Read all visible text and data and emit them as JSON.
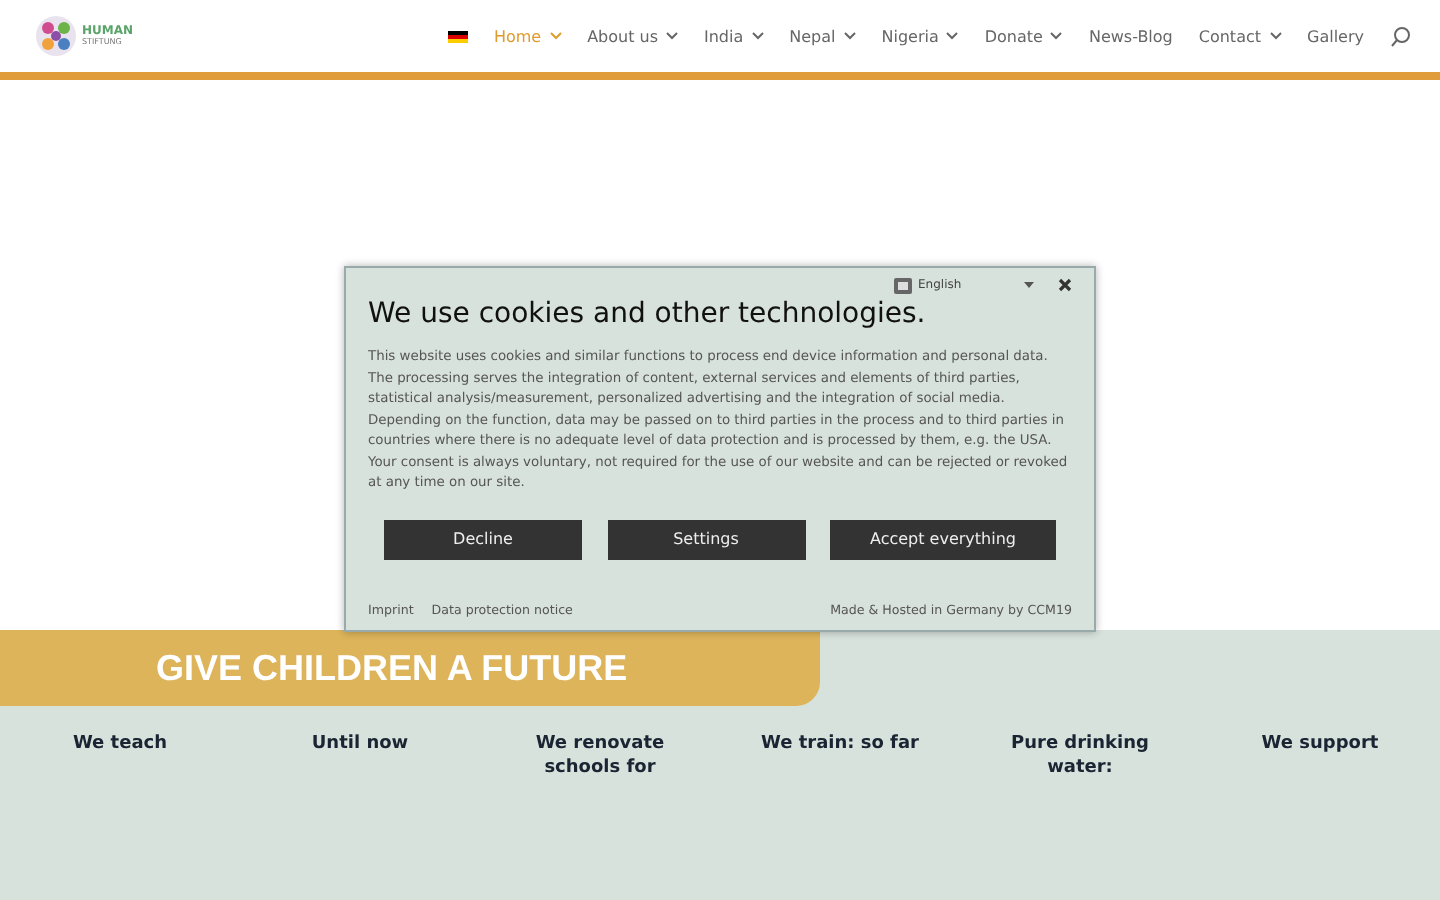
{
  "header": {
    "logo_text": "HUMAN",
    "logo_subtext": "STIFTUNG",
    "nav": [
      {
        "label": "Home",
        "selected": true,
        "has_menu": true
      },
      {
        "label": "About us",
        "selected": false,
        "has_menu": true
      },
      {
        "label": "India",
        "selected": false,
        "has_menu": true
      },
      {
        "label": "Nepal",
        "selected": false,
        "has_menu": true
      },
      {
        "label": "Nigeria",
        "selected": false,
        "has_menu": true
      },
      {
        "label": "Donate",
        "selected": false,
        "has_menu": true
      },
      {
        "label": "News-Blog",
        "selected": false,
        "has_menu": false
      },
      {
        "label": "Contact",
        "selected": false,
        "has_menu": true
      },
      {
        "label": "Gallery",
        "selected": false,
        "has_menu": false
      }
    ]
  },
  "banner": {
    "title": "GIVE CHILDREN A FUTURE"
  },
  "stats": [
    {
      "label": "We teach"
    },
    {
      "label": "Until now"
    },
    {
      "label": "We renovate schools for"
    },
    {
      "label": "We train: so far"
    },
    {
      "label": "Pure drinking water:"
    },
    {
      "label": "We support"
    }
  ],
  "cookie_dialog": {
    "language": "English",
    "title": "We use cookies and other technologies.",
    "text": "This website uses cookies and similar functions to process end device information and personal data. The processing serves the integration of content, external services and elements of third parties, statistical analysis/measurement, personalized advertising and the integration of social media. Depending on the function, data may be passed on to third parties in the process and to third parties in countries where there is no adequate level of data protection and is processed by them, e.g. the USA. Your consent is always voluntary, not required for the use of our website and can be rejected or revoked at any time on our site.",
    "buttons": [
      "Decline",
      "Settings",
      "Accept everything"
    ],
    "links": [
      "Imprint",
      "Data protection notice"
    ],
    "credit": "Made & Hosted in Germany by CCM19"
  }
}
